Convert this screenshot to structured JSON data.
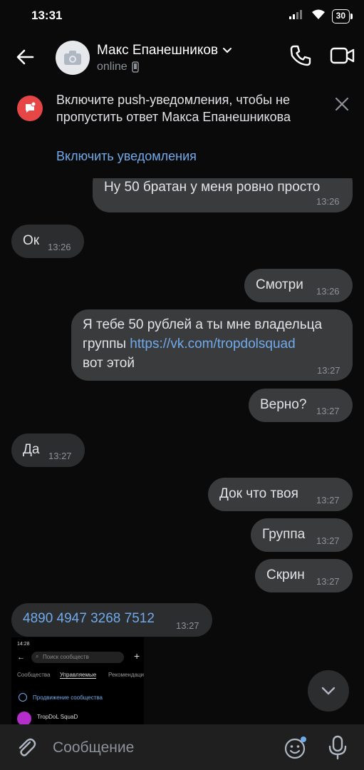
{
  "status_bar": {
    "time": "13:31",
    "battery": "30"
  },
  "header": {
    "contact_name": "Макс Епанешников",
    "contact_status": "online"
  },
  "push_banner": {
    "text": "Включите push-уведомления, чтобы не пропустить ответ Макса Епанешникова",
    "action": "Включить уведомления"
  },
  "messages": [
    {
      "dir": "out",
      "text": "Ну 50 братан у меня ровно просто",
      "time": "13:26"
    },
    {
      "dir": "in",
      "text": "Ок",
      "time": "13:26"
    },
    {
      "dir": "out",
      "text": "Смотри",
      "time": "13:26"
    },
    {
      "dir": "out",
      "line1": "Я тебе 50 рублей а ты мне владельца",
      "line2_prefix": "группы ",
      "link": "https://vk.com/tropdolsquad",
      "line3": "вот этой",
      "time": "13:27"
    },
    {
      "dir": "out",
      "text": "Верно?",
      "time": "13:27"
    },
    {
      "dir": "in",
      "text": "Да",
      "time": "13:27"
    },
    {
      "dir": "out",
      "text": "Док что твоя",
      "time": "13:27"
    },
    {
      "dir": "out",
      "text": "Группа",
      "time": "13:27"
    },
    {
      "dir": "out",
      "text": "Скрин",
      "time": "13:27"
    },
    {
      "dir": "in",
      "text": "4890 4947 3268 7512",
      "time": "13:27"
    }
  ],
  "screenshot_preview": {
    "time": "14:28",
    "search_placeholder": "Поиск сообществ",
    "tabs": [
      "Сообщества",
      "Управляемые",
      "Рекомендации"
    ],
    "promo": "Продвижение сообщества",
    "group_name": "TropDoL SquaD"
  },
  "composer": {
    "placeholder": "Сообщение"
  },
  "colors": {
    "accent": "#71aaeb",
    "bubble": "#2c2d2e",
    "background": "#0a0a0a",
    "push_icon": "#e64646"
  }
}
